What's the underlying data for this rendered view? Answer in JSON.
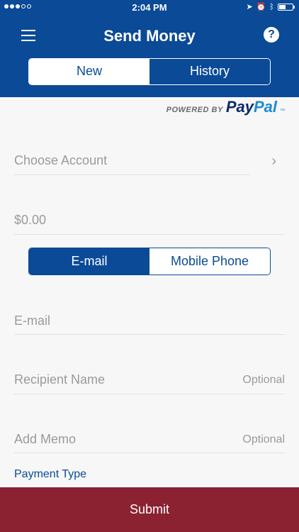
{
  "status_bar": {
    "time": "2:04 PM",
    "signal_icon": "signal-dots-icon",
    "icons": [
      "location-icon",
      "alarm-icon",
      "bluetooth-icon",
      "battery-icon"
    ],
    "battery_level": 0.5
  },
  "header": {
    "title": "Send Money",
    "menu_icon": "hamburger-menu-icon",
    "help_icon": "help-question-icon",
    "help_glyph": "?",
    "tabs": [
      {
        "label": "New",
        "active": true
      },
      {
        "label": "History",
        "active": false
      }
    ]
  },
  "powered_by": {
    "prefix": "POWERED BY",
    "brand_part1": "Pay",
    "brand_part2": "Pal",
    "trademark": "™"
  },
  "form": {
    "account_placeholder": "Choose Account",
    "amount_placeholder": "$0.00",
    "contact_tabs": [
      {
        "label": "E-mail",
        "active": true
      },
      {
        "label": "Mobile Phone",
        "active": false
      }
    ],
    "email_placeholder": "E-mail",
    "recipient_placeholder": "Recipient Name",
    "recipient_hint": "Optional",
    "memo_placeholder": "Add Memo",
    "memo_hint": "Optional",
    "payment_type_label": "Payment Type"
  },
  "submit_label": "Submit",
  "colors": {
    "primary_blue": "#0a4a97",
    "submit_red": "#8b2232",
    "placeholder_gray": "#9a9a9a",
    "background": "#f7f7f7"
  }
}
